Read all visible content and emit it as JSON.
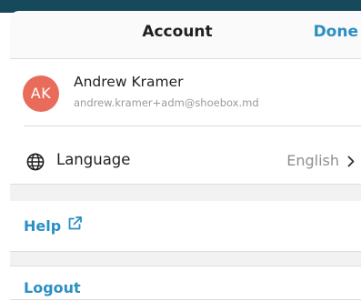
{
  "header": {
    "title": "Account",
    "done_label": "Done"
  },
  "account": {
    "initials": "AK",
    "name": "Andrew Kramer",
    "email": "andrew.kramer+adm@shoebox.md"
  },
  "language": {
    "label": "Language",
    "value": "English",
    "icon": "globe-icon"
  },
  "help": {
    "label": "Help",
    "icon": "external-link-icon"
  },
  "logout": {
    "label": "Logout"
  },
  "colors": {
    "accent": "#2b8fc3",
    "avatar": "#e96c5a",
    "top_strip": "#17495d",
    "section_background": "#f2f2f2"
  }
}
